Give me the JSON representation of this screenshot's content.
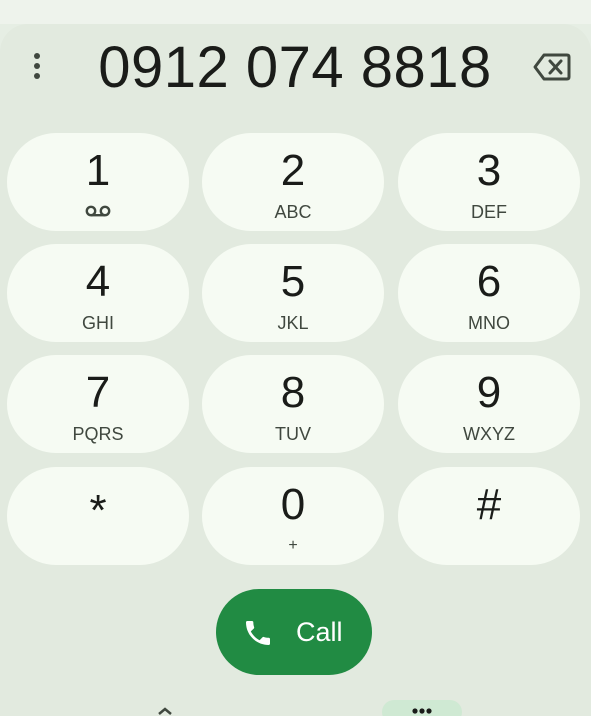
{
  "header": {
    "phone_number": "0912 074 8818"
  },
  "keypad": {
    "keys": [
      {
        "digit": "1",
        "letters": ""
      },
      {
        "digit": "2",
        "letters": "ABC"
      },
      {
        "digit": "3",
        "letters": "DEF"
      },
      {
        "digit": "4",
        "letters": "GHI"
      },
      {
        "digit": "5",
        "letters": "JKL"
      },
      {
        "digit": "6",
        "letters": "MNO"
      },
      {
        "digit": "7",
        "letters": "PQRS"
      },
      {
        "digit": "8",
        "letters": "TUV"
      },
      {
        "digit": "9",
        "letters": "WXYZ"
      },
      {
        "digit": "*",
        "letters": ""
      },
      {
        "digit": "0",
        "letters": "+"
      },
      {
        "digit": "#",
        "letters": ""
      }
    ]
  },
  "call_button": {
    "label": "Call"
  },
  "colors": {
    "background": "#e2eadf",
    "key_background": "#f6fbf3",
    "call_green": "#218b43",
    "text": "#1a1c19"
  },
  "icons": {
    "menu": "more-vert-icon",
    "backspace": "backspace-icon",
    "voicemail": "voicemail-icon",
    "call": "phone-icon"
  }
}
